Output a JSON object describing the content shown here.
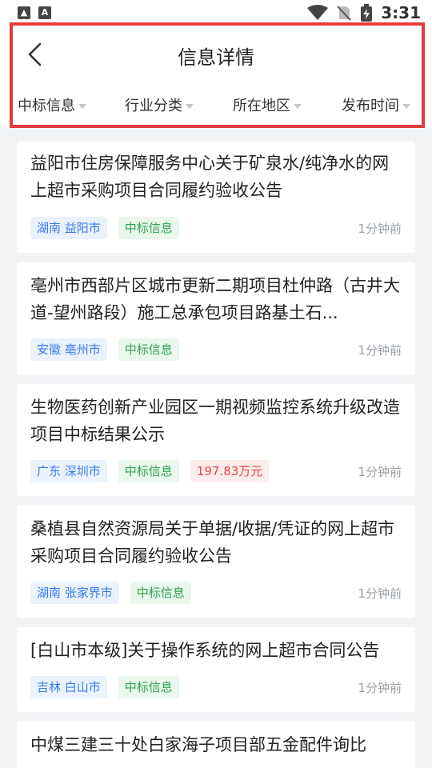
{
  "status_bar": {
    "left_icon_a": "A",
    "time": "3:31"
  },
  "header": {
    "title": "信息详情"
  },
  "filters": [
    {
      "label": "中标信息"
    },
    {
      "label": "行业分类"
    },
    {
      "label": "所在地区"
    },
    {
      "label": "发布时间"
    }
  ],
  "cards": [
    {
      "title": "益阳市住房保障服务中心关于矿泉水/纯净水的网上超市采购项目合同履约验收公告",
      "region": "湖南 益阳市",
      "type": "中标信息",
      "amount": "",
      "time": "1分钟前"
    },
    {
      "title": "亳州市西部片区城市更新二期项目杜仲路（古井大道-望州路段）施工总承包项目路基土石...",
      "region": "安徽 亳州市",
      "type": "中标信息",
      "amount": "",
      "time": "1分钟前"
    },
    {
      "title": "生物医药创新产业园区一期视频监控系统升级改造项目中标结果公示",
      "region": "广东 深圳市",
      "type": "中标信息",
      "amount": "197.83万元",
      "time": "1分钟前"
    },
    {
      "title": "桑植县自然资源局关于单据/收据/凭证的网上超市采购项目合同履约验收公告",
      "region": "湖南 张家界市",
      "type": "中标信息",
      "amount": "",
      "time": "1分钟前"
    },
    {
      "title": "[白山市本级]关于操作系统的网上超市合同公告",
      "region": "吉林 白山市",
      "type": "中标信息",
      "amount": "",
      "time": "1分钟前"
    },
    {
      "title": "中煤三建三十处白家海子项目部五金配件询比",
      "region": "",
      "type": "",
      "amount": "",
      "time": ""
    }
  ],
  "colors": {
    "highlight": "#e33b3b",
    "region_tag": "#3b7be9",
    "type_tag": "#2fa24d",
    "amount_tag": "#e04848"
  }
}
